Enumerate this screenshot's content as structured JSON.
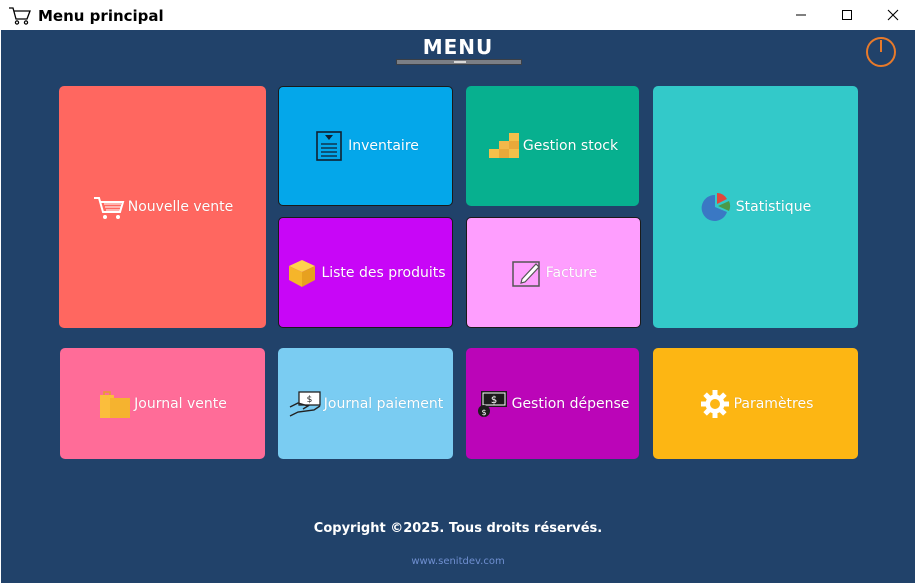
{
  "window": {
    "title": "Menu principal",
    "icon": "shopping-cart-icon"
  },
  "menu": {
    "title": "MENU"
  },
  "tiles": {
    "nouvelle_vente": {
      "label": "Nouvelle vente",
      "icon": "cart-icon",
      "color": "#ff6760"
    },
    "inventaire": {
      "label": "Inventaire",
      "icon": "document-list-icon",
      "color": "#04a7ea"
    },
    "gestion_stock": {
      "label": "Gestion stock",
      "icon": "boxes-icon",
      "color": "#07b08f"
    },
    "statistique": {
      "label": "Statistique",
      "icon": "pie-chart-icon",
      "color": "#33c9c9"
    },
    "liste_produits": {
      "label": "Liste des produits",
      "icon": "box-icon",
      "color": "#c806f7"
    },
    "facture": {
      "label": "Facture",
      "icon": "edit-document-icon",
      "color": "#fe9efe"
    },
    "journal_vente": {
      "label": "Journal vente",
      "icon": "shopping-bag-icon",
      "color": "#ff6c98"
    },
    "journal_paiement": {
      "label": "Journal paiement",
      "icon": "payment-hand-icon",
      "color": "#7accf2"
    },
    "gestion_depense": {
      "label": "Gestion dépense",
      "icon": "money-icon",
      "color": "#bb05b8"
    },
    "parametres": {
      "label": "Paramètres",
      "icon": "gear-icon",
      "color": "#fdb613"
    }
  },
  "footer": {
    "copyright": "Copyright ©2025. Tous droits réservés.",
    "website": "www.senitdev.com"
  }
}
